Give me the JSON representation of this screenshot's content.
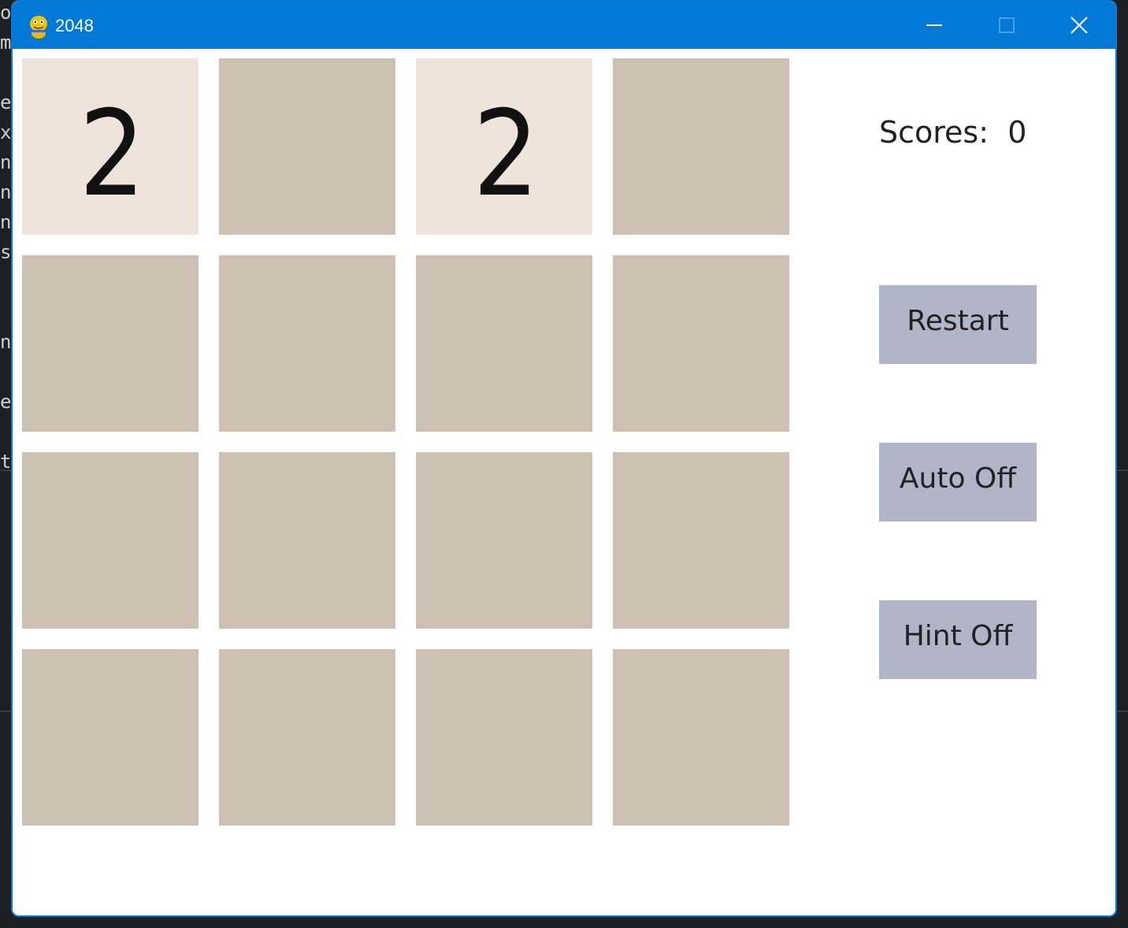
{
  "window": {
    "title": "2048",
    "icon": "pygame-snake-icon",
    "controls": {
      "minimize_icon": "minimize-icon",
      "maximize_icon": "maximize-icon",
      "close_icon": "close-icon"
    }
  },
  "board": {
    "rows": [
      [
        "2",
        "",
        "2",
        ""
      ],
      [
        "",
        "",
        "",
        ""
      ],
      [
        "",
        "",
        "",
        ""
      ],
      [
        "",
        "",
        "",
        ""
      ]
    ],
    "empty_color": "#cdc1b4",
    "tile_2_color": "#eee4da"
  },
  "sidebar": {
    "scores_label": "Scores:",
    "scores_value": "0",
    "restart_label": "Restart",
    "auto_label": "Auto Off",
    "hint_label": "Hint Off",
    "button_color": "#b2b4c8"
  },
  "background": {
    "left_chars": [
      "o",
      "m",
      "",
      "e",
      "x",
      "n",
      "n",
      "n",
      "s",
      "",
      "",
      "n",
      "",
      "e",
      "",
      "t"
    ],
    "accent": "#0379d7"
  }
}
